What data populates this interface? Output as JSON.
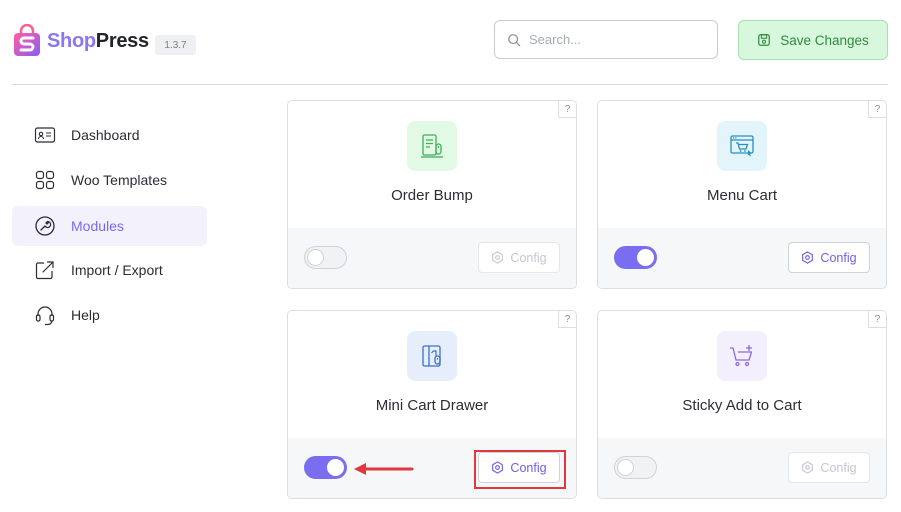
{
  "header": {
    "brand_part1": "Shop",
    "brand_part2": "Press",
    "version": "1.3.7",
    "search_placeholder": "Search...",
    "save_label": "Save Changes"
  },
  "sidebar": {
    "items": [
      {
        "label": "Dashboard",
        "icon": "dashboard-icon",
        "active": false
      },
      {
        "label": "Woo Templates",
        "icon": "templates-grid-icon",
        "active": false
      },
      {
        "label": "Modules",
        "icon": "modules-icon",
        "active": true
      },
      {
        "label": "Import / Export",
        "icon": "import-export-icon",
        "active": false
      },
      {
        "label": "Help",
        "icon": "headset-icon",
        "active": false
      }
    ]
  },
  "modules": [
    {
      "title": "Order Bump",
      "icon": "order-bump-icon",
      "icon_bg": "#e2f9e6",
      "enabled": false,
      "config_label": "Config",
      "help": "?"
    },
    {
      "title": "Menu Cart",
      "icon": "menu-cart-icon",
      "icon_bg": "#e3f5fb",
      "enabled": true,
      "config_label": "Config",
      "help": "?"
    },
    {
      "title": "Mini Cart Drawer",
      "icon": "mini-cart-drawer-icon",
      "icon_bg": "#e7eefb",
      "enabled": true,
      "config_label": "Config",
      "help": "?"
    },
    {
      "title": "Sticky Add to Cart",
      "icon": "sticky-add-to-cart-icon",
      "icon_bg": "#f3effc",
      "enabled": false,
      "config_label": "Config",
      "help": "?"
    }
  ],
  "colors": {
    "accent": "#7b6df0",
    "save_bg": "#d7f8dc",
    "save_text": "#2f8a3c",
    "annotation": "#e0383f"
  }
}
